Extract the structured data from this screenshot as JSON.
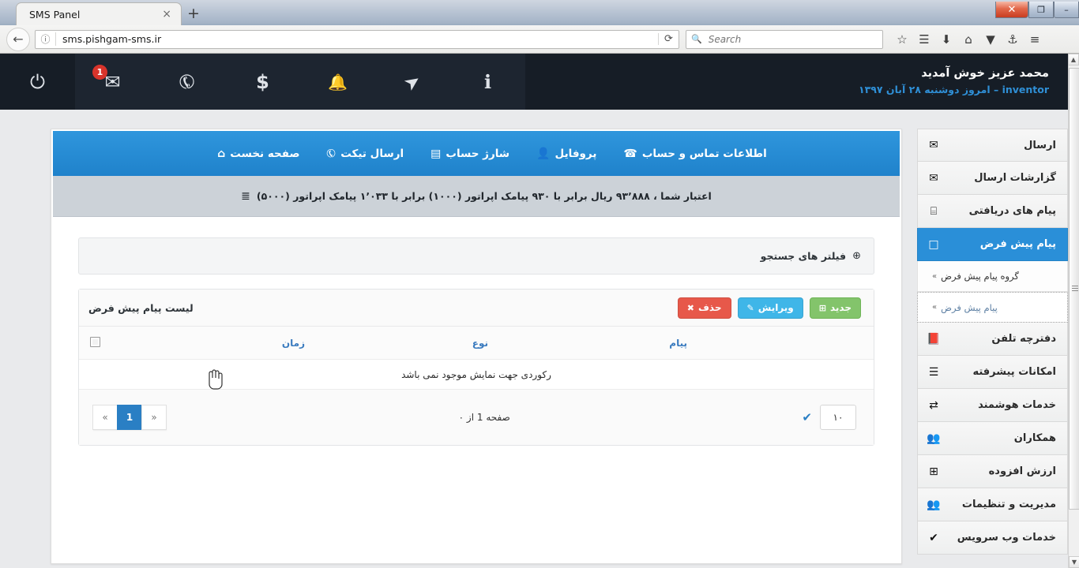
{
  "browser": {
    "tab_title": "SMS Panel",
    "tab_close_glyph": "×",
    "new_tab_glyph": "+",
    "back_glyph": "←",
    "site_info_glyph": "ⓘ",
    "url": "sms.pishgam-sms.ir",
    "reload_glyph": "⟳",
    "search_placeholder": "Search",
    "search_glyph": "🔍",
    "toolbar_icons": [
      "☆",
      "☰",
      "⬇",
      "⌂",
      "▼",
      "⚓"
    ],
    "menu_glyph": "≡",
    "window_buttons": {
      "minimize": "–",
      "restore": "❐",
      "close": "✕"
    }
  },
  "header": {
    "icons": [
      {
        "name": "power-icon",
        "glyph": "⏻",
        "badge": null,
        "active": false
      },
      {
        "name": "envelope-icon",
        "glyph": "✉",
        "badge": "1",
        "active": true
      },
      {
        "name": "ticket-icon",
        "glyph": "✆",
        "badge": null,
        "active": true
      },
      {
        "name": "dollar-icon",
        "glyph": "$",
        "badge": null,
        "active": true
      },
      {
        "name": "bell-icon",
        "glyph": "🔔",
        "badge": null,
        "active": true
      },
      {
        "name": "paper-plane-icon",
        "glyph": "➤",
        "badge": null,
        "active": true
      },
      {
        "name": "info-icon",
        "glyph": "ℹ",
        "badge": null,
        "active": true
      }
    ],
    "welcome_name": "محمد عزیز خوش آمدید",
    "welcome_date": "inventor – امروز دوشنبه ۲۸ آبان ۱۳۹۷"
  },
  "topnav": {
    "items": [
      {
        "label": "صفحه نخست",
        "icon": "⌂",
        "icon_name": "home-icon"
      },
      {
        "label": "ارسال تیکت",
        "icon": "✆",
        "icon_name": "ticket-icon"
      },
      {
        "label": "شارژ حساب",
        "icon": "▤",
        "icon_name": "credit-card-icon"
      },
      {
        "label": "پروفایل",
        "icon": "👤",
        "icon_name": "user-icon"
      },
      {
        "label": "اطلاعات تماس و حساب",
        "icon": "☎",
        "icon_name": "phone-icon"
      }
    ]
  },
  "credit": {
    "icon": "≣",
    "text": "اعتبار شما ، ۹۳٬۸۸۸ ریال برابر با ۹۳۰ پیامک اپراتور (۱۰۰۰) برابر با ۱٬۰۳۳ پیامک اپراتور (۵۰۰۰)"
  },
  "filters": {
    "label": "فیلتر های جستجو",
    "plus_glyph": "⊕"
  },
  "list": {
    "title": "لیست پیام پیش فرض",
    "buttons": [
      {
        "label": "حذف",
        "icon": "✖",
        "color": "red",
        "name": "delete-button"
      },
      {
        "label": "ویرایش",
        "icon": "✎",
        "color": "blue",
        "name": "edit-button"
      },
      {
        "label": "جدید",
        "icon": "⊞",
        "color": "green",
        "name": "new-button"
      }
    ],
    "columns": {
      "message": "پیام",
      "type": "نوع",
      "time": "زمان"
    },
    "empty_text": "رکوردی جهت نمایش موجود نمی باشد",
    "rows": []
  },
  "pagination": {
    "page_size": "۱۰",
    "check_glyph": "✔",
    "info": "صفحه 1 از ۰",
    "first_glyph": "«",
    "current_page": "1",
    "last_glyph": "»"
  },
  "sidebar": {
    "items": [
      {
        "label": "ارسال",
        "icon": "✉",
        "icon_name": "envelope-filled-icon",
        "active": false
      },
      {
        "label": "گزارشات ارسال",
        "icon": "✉",
        "icon_name": "envelope-outline-icon",
        "active": false
      },
      {
        "label": "پیام های دریافتی",
        "icon": "⌸",
        "icon_name": "inbox-icon",
        "active": false
      },
      {
        "label": "پیام پیش فرض",
        "icon": "□",
        "icon_name": "note-icon",
        "active": true
      }
    ],
    "subitems": [
      {
        "label": "گروه پیام پیش فرض",
        "focused": false
      },
      {
        "label": "پیام پیش فرض",
        "focused": true
      }
    ],
    "items2": [
      {
        "label": "دفترچه تلفن",
        "icon": "📕",
        "icon_name": "phonebook-icon"
      },
      {
        "label": "امکانات پیشرفته",
        "icon": "☰",
        "icon_name": "advanced-icon"
      },
      {
        "label": "خدمات هوشمند",
        "icon": "⇄",
        "icon_name": "smart-services-icon"
      },
      {
        "label": "همکاران",
        "icon": "👥",
        "icon_name": "partners-icon"
      },
      {
        "label": "ارزش افزوده",
        "icon": "⊞",
        "icon_name": "value-added-icon"
      },
      {
        "label": "مدیریت و تنظیمات",
        "icon": "👥",
        "icon_name": "management-icon"
      },
      {
        "label": "خدمات وب سرویس",
        "icon": "✔",
        "icon_name": "webservice-icon"
      }
    ]
  },
  "colors": {
    "accent_blue": "#2a8fd8",
    "header_dark": "#161d26",
    "danger": "#e7584a",
    "info": "#3fb6e8",
    "success": "#83c46b"
  }
}
